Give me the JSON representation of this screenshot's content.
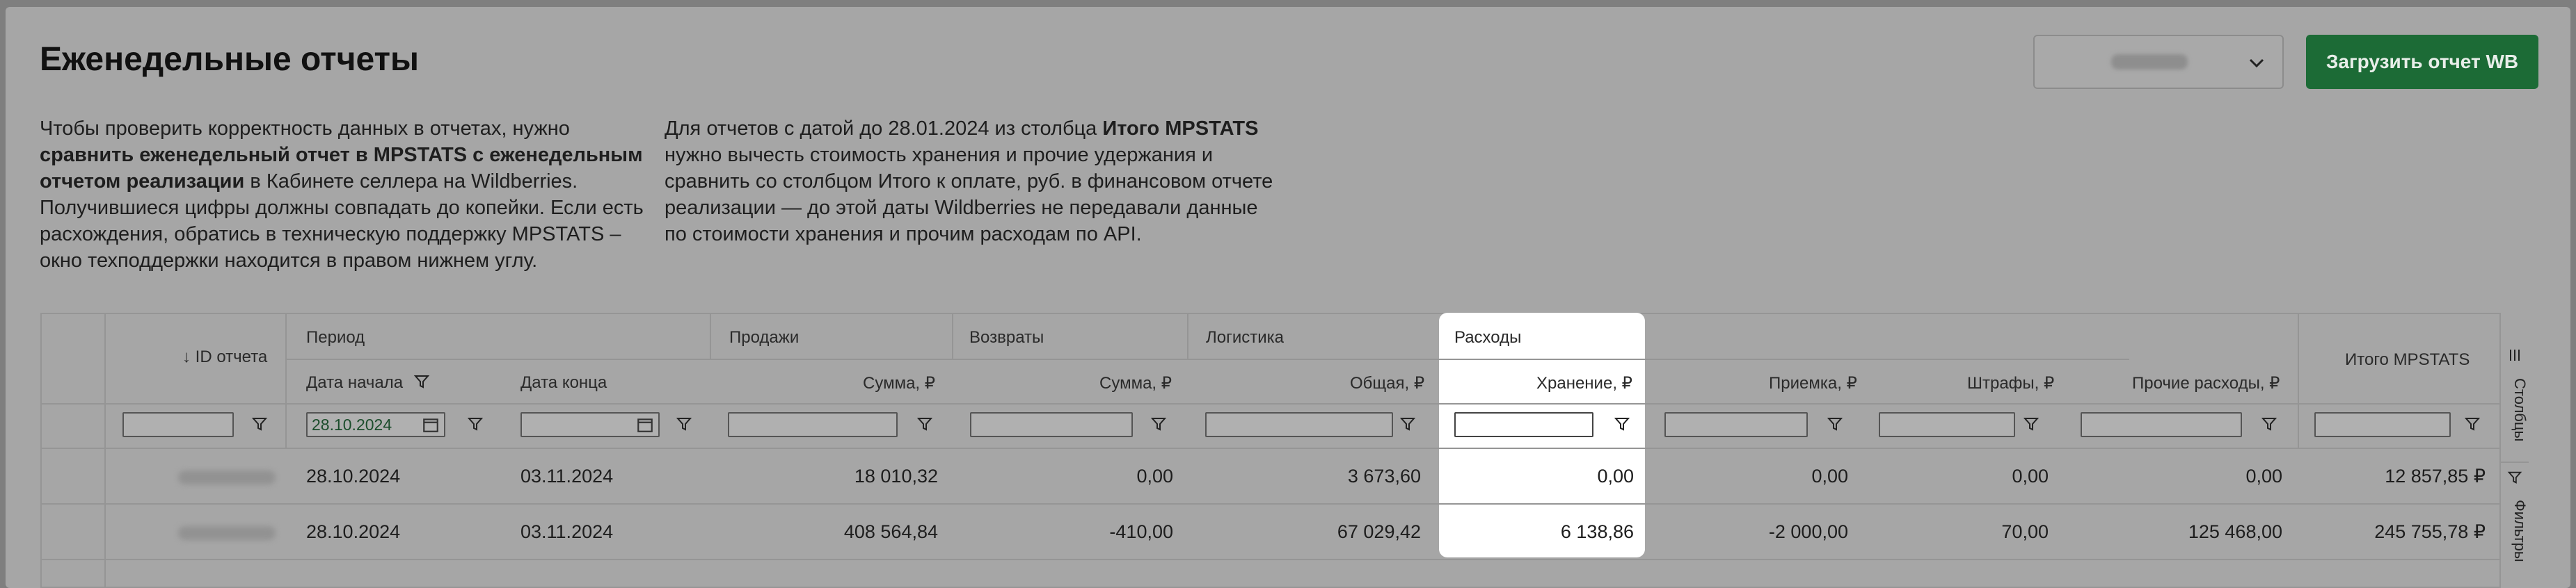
{
  "page": {
    "title": "Еженедельные отчеты",
    "desc1": {
      "p1": "Чтобы проверить корректность данных в отчетах, нужно ",
      "b1": "сравнить еженедельный отчет в MPSTATS с еженедельным отчетом реализации",
      "p2": " в Кабинете селлера на Wildberries. Получившиеся цифры должны совпадать до копейки. Если есть расхождения, обратись в техническую поддержку MPSTATS – окно техподдержки находится в правом нижнем углу."
    },
    "desc2": {
      "p1": "Для отчетов с датой до 28.01.2024 из столбца ",
      "b1": "Итого MPSTATS",
      "p2": " нужно вычесть стоимость хранения и прочие удержания и сравнить со столбцом Итого к оплате, руб. в финансовом отчете реализации — до этой даты Wildberries не передавали данные по стоимости хранения и прочим расходам по API."
    }
  },
  "toolbar": {
    "upload_label": "Загрузить отчет WB",
    "select_icon": "chevron-down-icon"
  },
  "grid": {
    "groups": {
      "id": "↓ ID отчета",
      "period": "Период",
      "sales": "Продажи",
      "returns": "Возвраты",
      "logistics": "Логистика",
      "expenses": "Расходы",
      "total": "Итого MPSTATS"
    },
    "columns": {
      "date_start": "Дата начала",
      "date_end": "Дата конца",
      "sales_sum": "Сумма, ₽",
      "returns_sum": "Сумма, ₽",
      "logistics_total": "Общая, ₽",
      "storage": "Хранение, ₽",
      "acceptance": "Приемка, ₽",
      "fines": "Штрафы, ₽",
      "other": "Прочие расходы, ₽"
    },
    "filters": {
      "date_start_value": "28.10.2024"
    },
    "rows": [
      {
        "date_start": "28.10.2024",
        "date_end": "03.11.2024",
        "sales_sum": "18 010,32",
        "returns_sum": "0,00",
        "logistics_total": "3 673,60",
        "storage": "0,00",
        "acceptance": "0,00",
        "fines": "0,00",
        "other": "0,00",
        "total": "12 857,85 ₽"
      },
      {
        "date_start": "28.10.2024",
        "date_end": "03.11.2024",
        "sales_sum": "408 564,84",
        "returns_sum": "-410,00",
        "logistics_total": "67 029,42",
        "storage": "6 138,86",
        "acceptance": "-2 000,00",
        "fines": "70,00",
        "other": "125 468,00",
        "total": "245 755,78 ₽"
      }
    ],
    "side": {
      "columns_tab": "Столбцы",
      "filters_tab": "Фильтры"
    }
  }
}
